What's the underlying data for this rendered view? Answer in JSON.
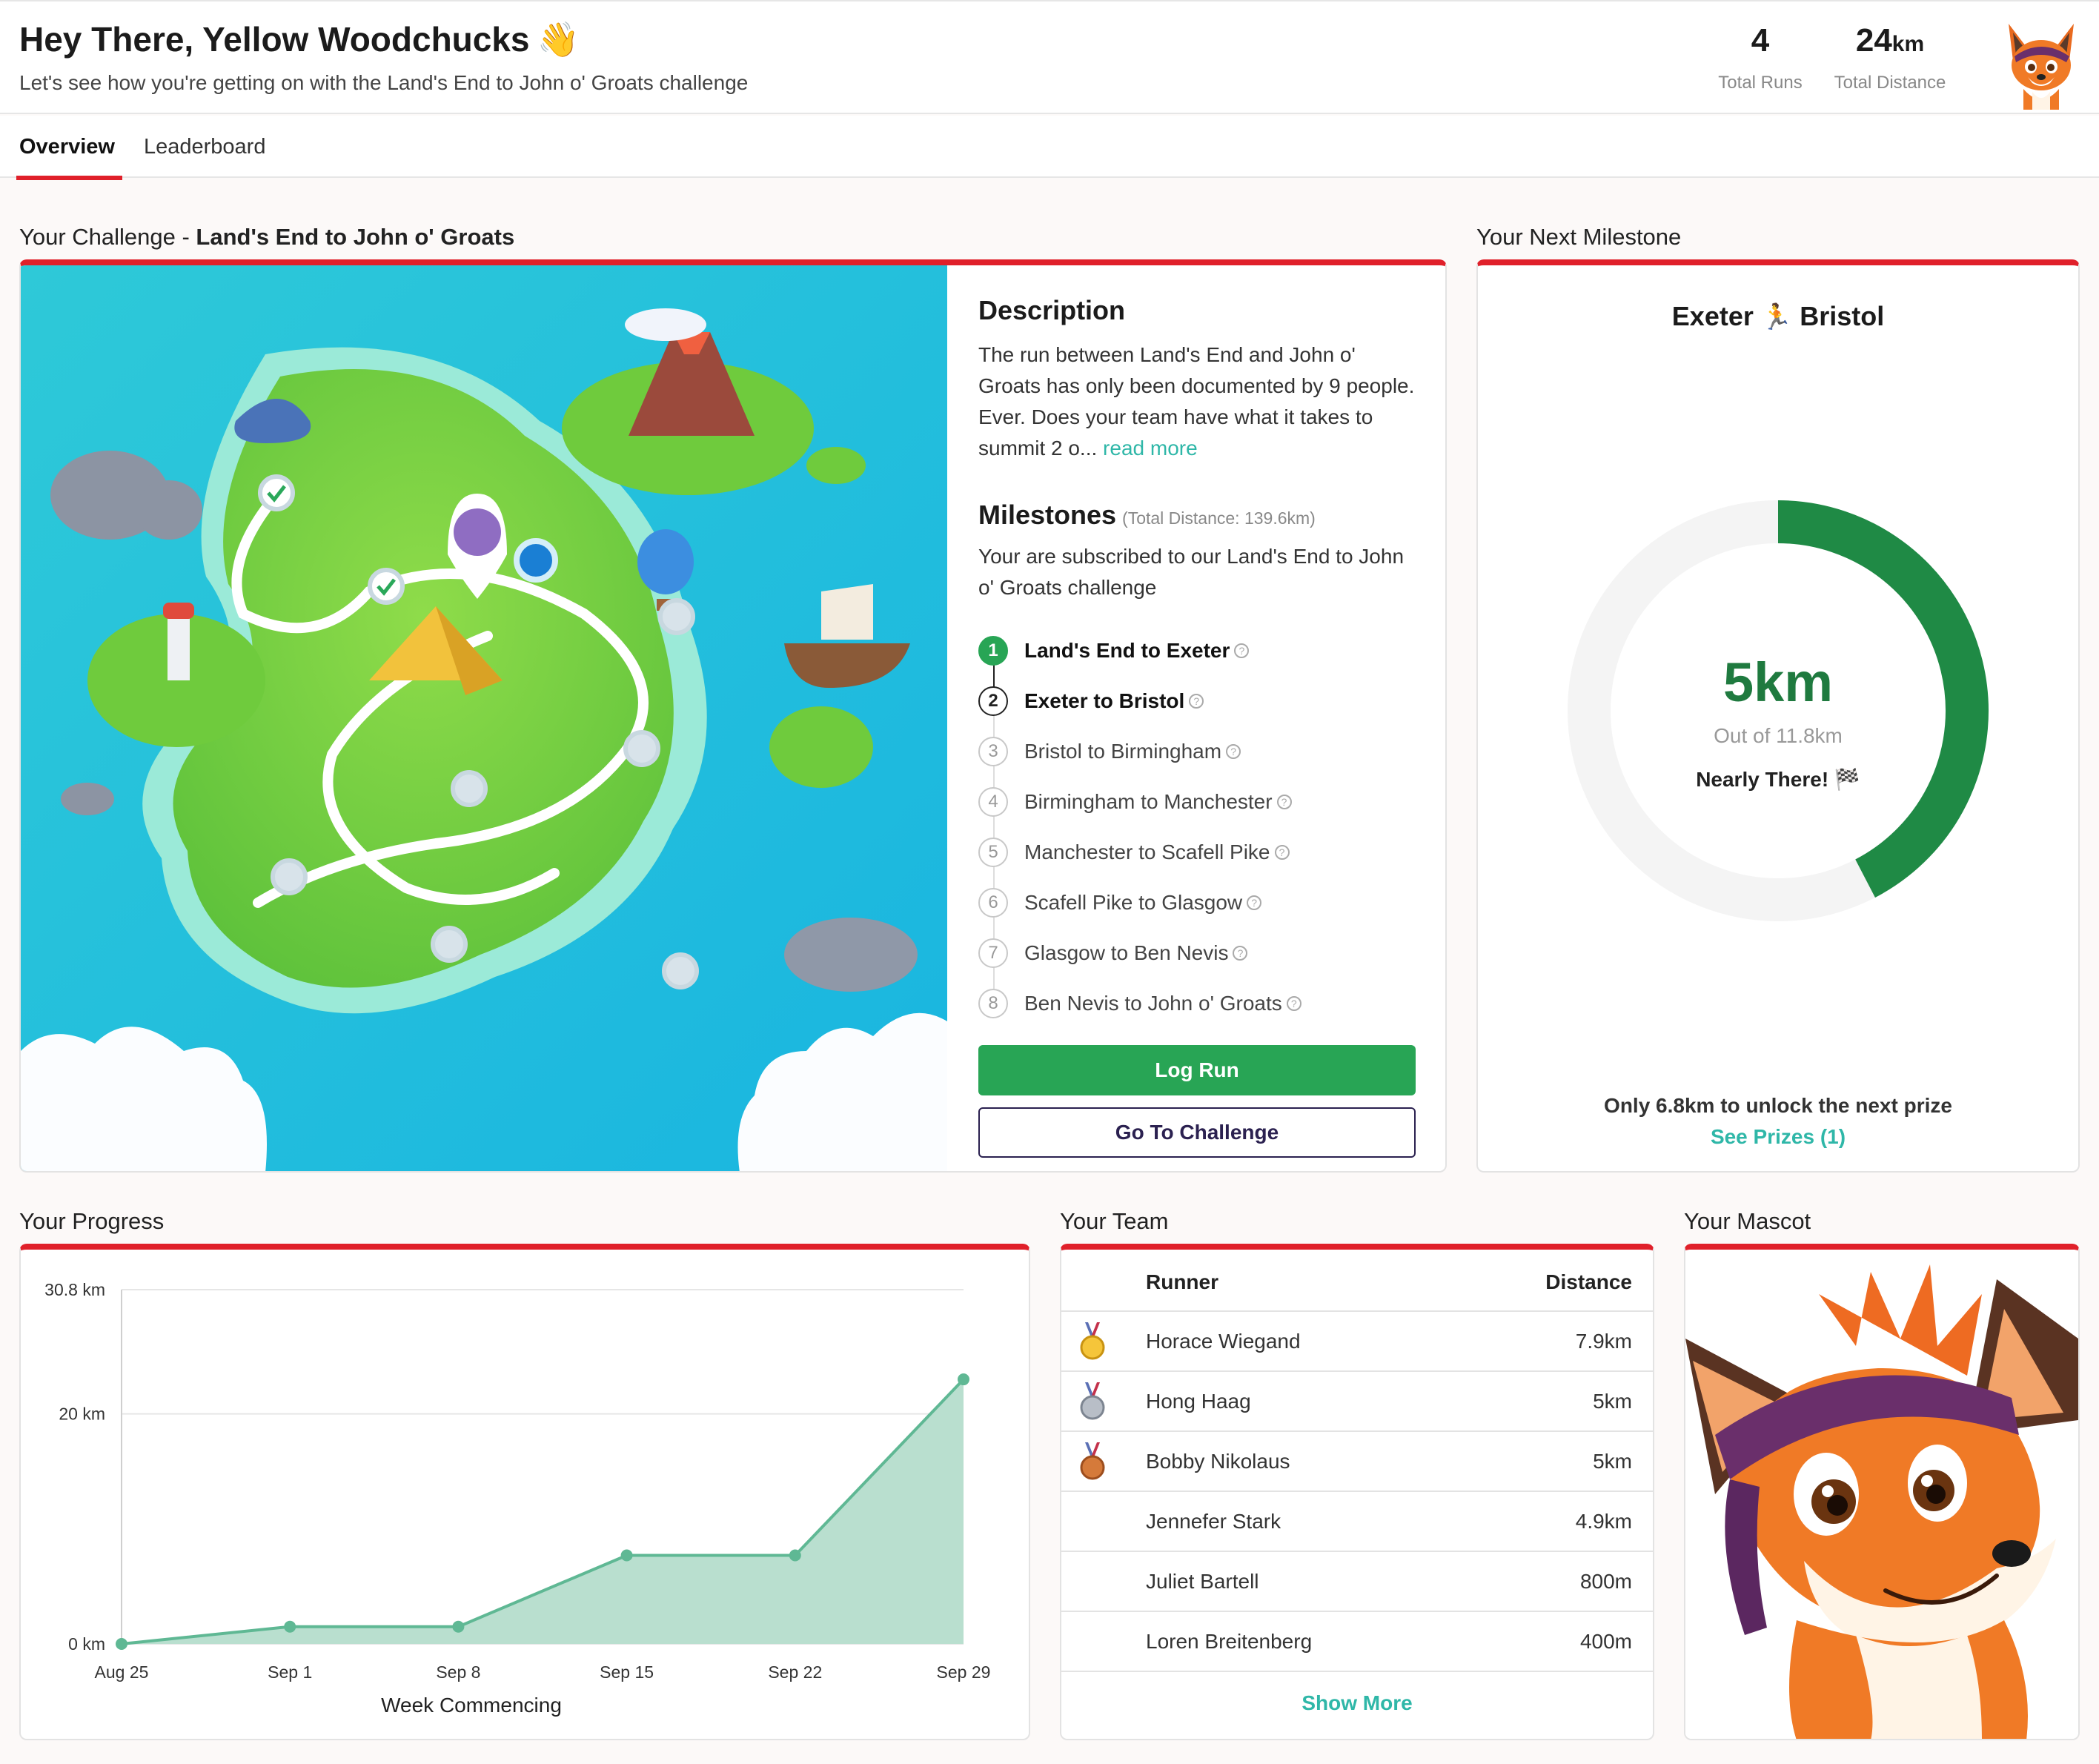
{
  "header": {
    "greeting": "Hey There, Yellow Woodchucks",
    "wave_emoji": "👋",
    "subtitle": "Let's see how you're getting on with the Land's End to John o' Groats challenge",
    "stats": {
      "total_runs_value": "4",
      "total_runs_label": "Total Runs",
      "total_distance_value": "24",
      "total_distance_unit": "km",
      "total_distance_label": "Total Distance"
    },
    "avatar_icon": "fox-mascot-avatar"
  },
  "tabs": [
    {
      "label": "Overview",
      "active": true
    },
    {
      "label": "Leaderboard",
      "active": false
    }
  ],
  "challenge": {
    "section_title_prefix": "Your Challenge - ",
    "section_title_name": "Land's End to John o' Groats",
    "description_heading": "Description",
    "description_text": "The run between Land's End and John o' Groats has only been documented by 9 people. Ever. Does your team have what it takes to summit 2 o...",
    "read_more": "read more",
    "milestones_heading": "Milestones",
    "milestones_total": "(Total Distance: 139.6km)",
    "milestones_subtitle": "Your are subscribed to our Land's End to John o' Groats challenge",
    "milestones": [
      {
        "num": "1",
        "label": "Land's End to Exeter",
        "state": "done"
      },
      {
        "num": "2",
        "label": "Exeter to Bristol",
        "state": "current"
      },
      {
        "num": "3",
        "label": "Bristol to Birmingham",
        "state": "upcoming"
      },
      {
        "num": "4",
        "label": "Birmingham to Manchester",
        "state": "upcoming"
      },
      {
        "num": "5",
        "label": "Manchester to Scafell Pike",
        "state": "upcoming"
      },
      {
        "num": "6",
        "label": "Scafell Pike to Glasgow",
        "state": "upcoming"
      },
      {
        "num": "7",
        "label": "Glasgow to Ben Nevis",
        "state": "upcoming"
      },
      {
        "num": "8",
        "label": "Ben Nevis to John o' Groats",
        "state": "upcoming"
      }
    ],
    "log_run_label": "Log Run",
    "go_to_challenge_label": "Go To Challenge"
  },
  "next_milestone": {
    "section_title": "Your Next Milestone",
    "from": "Exeter",
    "to": "Bristol",
    "runner_icon": "🏃",
    "progress_value": "5km",
    "progress_fraction": 0.4237,
    "out_of": "Out of 11.8km",
    "status": "Nearly There! 🏁",
    "prize_note": "Only 6.8km to unlock the next prize",
    "see_prizes": "See Prizes (1)",
    "ring_color": "#1f8a45",
    "ring_track_color": "#f4f4f4"
  },
  "progress": {
    "section_title": "Your Progress"
  },
  "chart_data": {
    "type": "area",
    "categories": [
      "Aug 25",
      "Sep 1",
      "Sep 8",
      "Sep 15",
      "Sep 22",
      "Sep 29"
    ],
    "values": [
      0,
      1.5,
      1.5,
      7.7,
      7.7,
      23
    ],
    "xlabel": "Week Commencing",
    "ylabel": "",
    "y_ticks": [
      "0 km",
      "20 km",
      "30.8 km"
    ],
    "y_tick_values": [
      0,
      20,
      30.8
    ],
    "ylim": [
      0,
      30.8
    ],
    "grid": true,
    "line_color": "#5fb894",
    "fill_color": "#b9dfcf"
  },
  "team": {
    "section_title": "Your Team",
    "col_runner": "Runner",
    "col_distance": "Distance",
    "rows": [
      {
        "medal": "gold",
        "runner": "Horace Wiegand",
        "distance": "7.9km"
      },
      {
        "medal": "silver",
        "runner": "Hong Haag",
        "distance": "5km"
      },
      {
        "medal": "bronze",
        "runner": "Bobby Nikolaus",
        "distance": "5km"
      },
      {
        "medal": "",
        "runner": "Jennefer Stark",
        "distance": "4.9km"
      },
      {
        "medal": "",
        "runner": "Juliet Bartell",
        "distance": "800m"
      },
      {
        "medal": "",
        "runner": "Loren Breitenberg",
        "distance": "400m"
      }
    ],
    "show_more": "Show More"
  },
  "mascot": {
    "section_title": "Your Mascot",
    "icon": "fox-mascot-illustration"
  }
}
